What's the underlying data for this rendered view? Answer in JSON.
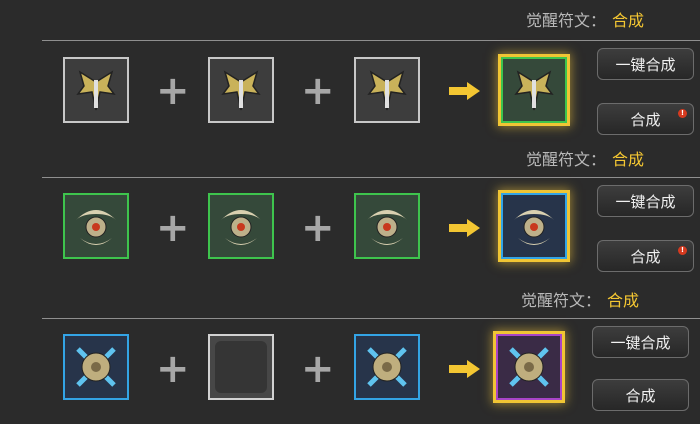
{
  "rows": [
    {
      "header_label": "觉醒符文：",
      "header_value": "合成",
      "slots": [
        {
          "icon": "winged-sword-rune-icon",
          "rarity": "gray"
        },
        {
          "icon": "winged-sword-rune-icon",
          "rarity": "gray"
        },
        {
          "icon": "winged-sword-rune-icon",
          "rarity": "gray"
        }
      ],
      "result": {
        "icon": "winged-sword-rune-icon",
        "rarity": "green"
      },
      "auto_btn": "一键合成",
      "btn": "合成",
      "btn_badge": "!"
    },
    {
      "header_label": "觉醒符文：",
      "header_value": "合成",
      "slots": [
        {
          "icon": "thorn-amulet-rune-icon",
          "rarity": "green"
        },
        {
          "icon": "thorn-amulet-rune-icon",
          "rarity": "green"
        },
        {
          "icon": "thorn-amulet-rune-icon",
          "rarity": "green"
        }
      ],
      "result": {
        "icon": "thorn-amulet-rune-icon",
        "rarity": "blue"
      },
      "auto_btn": "一键合成",
      "btn": "合成",
      "btn_badge": "!"
    },
    {
      "header_label": "觉醒符文：",
      "header_value": "合成",
      "slots": [
        {
          "icon": "cross-shield-rune-icon",
          "rarity": "blue"
        },
        {
          "icon": "empty-slot",
          "rarity": "empty"
        },
        {
          "icon": "cross-shield-rune-icon",
          "rarity": "blue"
        }
      ],
      "result": {
        "icon": "cross-shield-rune-icon",
        "rarity": "purple"
      },
      "auto_btn": "一键合成",
      "btn": "合成",
      "btn_badge": ""
    }
  ],
  "colors": {
    "accent": "#f3c632",
    "green": "#3ec44d",
    "blue": "#33a4e6",
    "purple": "#a845c7"
  }
}
